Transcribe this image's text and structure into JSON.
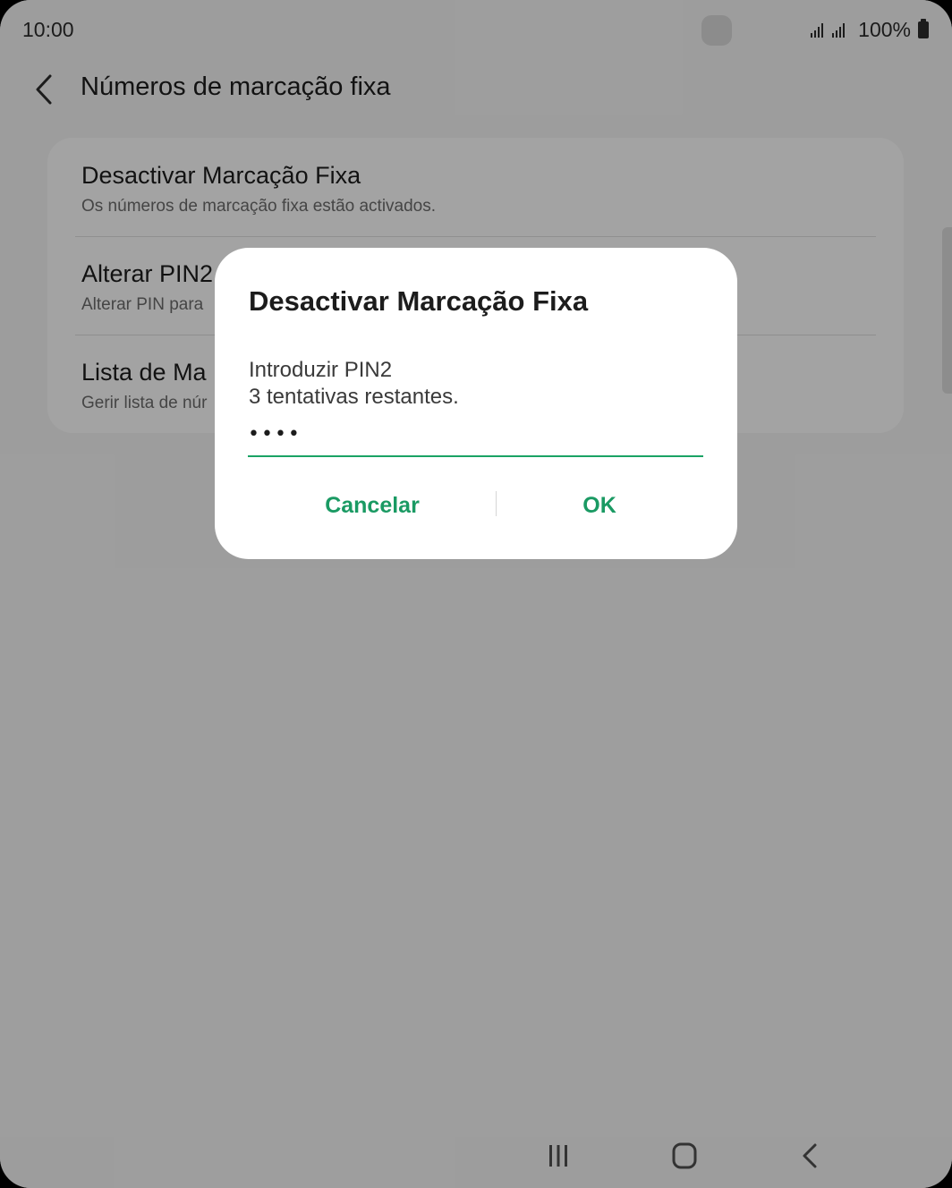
{
  "status_bar": {
    "time": "10:00",
    "battery": "100%"
  },
  "header": {
    "title": "Números de marcação fixa"
  },
  "settings": {
    "items": [
      {
        "title": "Desactivar Marcação Fixa",
        "subtitle": "Os números de marcação fixa estão activados."
      },
      {
        "title": "Alterar PIN2",
        "subtitle": "Alterar PIN para"
      },
      {
        "title": "Lista de Ma",
        "subtitle": "Gerir lista de núr"
      }
    ]
  },
  "dialog": {
    "title": "Desactivar Marcação Fixa",
    "prompt": "Introduzir PIN2",
    "attempts": "3 tentativas restantes.",
    "pin_value": "••••",
    "cancel_label": "Cancelar",
    "ok_label": "OK"
  },
  "colors": {
    "accent": "#1a9a63",
    "underline": "#1aa365",
    "dim_overlay": "rgba(0,0,0,0.35)"
  },
  "icons": {
    "back": "chevron-left-icon",
    "recents": "recent-apps-icon",
    "home": "home-icon",
    "nav_back": "nav-back-icon"
  }
}
